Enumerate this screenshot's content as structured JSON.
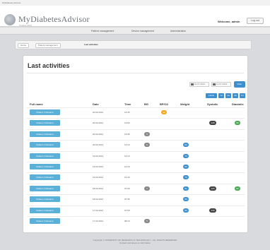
{
  "topbar": {
    "meta": "MyDiabetes Advisor"
  },
  "header": {
    "title": "MyDiabetesAdvisor",
    "subtitle": "Product 2014",
    "welcome": "Welcome, admin",
    "logout_label": "Log out"
  },
  "nav": {
    "items": [
      "Patient management",
      "Device management",
      "Administration"
    ]
  },
  "breadcrumb": {
    "items": [
      "Home",
      "Patient management",
      "Last activities"
    ]
  },
  "panel": {
    "title": "Last activities",
    "date_from": "01.07.2014",
    "date_to": "14.07.2014",
    "filter_label": "Filter",
    "ranges": [
      "Latest",
      "1d",
      "1w",
      "2w",
      "1m"
    ]
  },
  "table": {
    "headers": [
      "Full name",
      "Date",
      "Time",
      "BG",
      "BP/O2",
      "Weight",
      "Systolic",
      "Diastolic"
    ],
    "rows": [
      {
        "name": "Patient, Firstname",
        "date": "20.02.2014",
        "time": "12:45",
        "badges": {
          "bpo2": "12"
        }
      },
      {
        "name": "Patient, Firstname",
        "date": "20.02.2014",
        "time": "13:00",
        "badges": {
          "sys": "128",
          "dia": "80"
        }
      },
      {
        "name": "Patient, Firstname",
        "date": "20.02.2014",
        "time": "13:05",
        "badges": {
          "bg": "5"
        }
      },
      {
        "name": "Patient, Firstname",
        "date": "20.02.2014",
        "time": "13:10",
        "badges": {
          "bg": "6",
          "weight": "80"
        }
      },
      {
        "name": "Patient, Firstname",
        "date": "19.02.2014",
        "time": "12:10",
        "badges": {
          "weight": "79"
        }
      },
      {
        "name": "Patient, Firstname",
        "date": "19.02.2014",
        "time": "12:15",
        "badges": {
          "weight": "80"
        }
      },
      {
        "name": "Patient, Firstname",
        "date": "19.02.2014",
        "time": "12:40",
        "badges": {
          "weight": "79"
        }
      },
      {
        "name": "Patient, Firstname",
        "date": "18.02.2014",
        "time": "07:30",
        "badges": {
          "bg": "7",
          "weight": "81",
          "sys": "125",
          "dia": "82"
        }
      },
      {
        "name": "Patient, Firstname",
        "date": "18.02.2014",
        "time": "07:45",
        "badges": {
          "weight": "80"
        }
      },
      {
        "name": "Patient, Firstname",
        "date": "17.02.2014",
        "time": "07:50",
        "badges": {
          "weight": "80",
          "sys": "130"
        }
      },
      {
        "name": "Patient, Firstname",
        "date": "17.02.2014",
        "time": "08:10",
        "badges": {
          "bg": "5"
        }
      }
    ]
  },
  "colors": {
    "bg_badge": "#8a8a8a",
    "bpo2_badge": "#f0a92a",
    "weight_badge": "#3d8fcf",
    "systolic_badge": "#444444",
    "diastolic_badge": "#4aa857",
    "name_button": "#5bb0d8"
  },
  "footer": {
    "line1": "Copyright © UNIVERSITY OF RESEARCH & TECHNOLOGY - ALL RIGHTS RESERVED",
    "line2": "Contact and about us information"
  }
}
